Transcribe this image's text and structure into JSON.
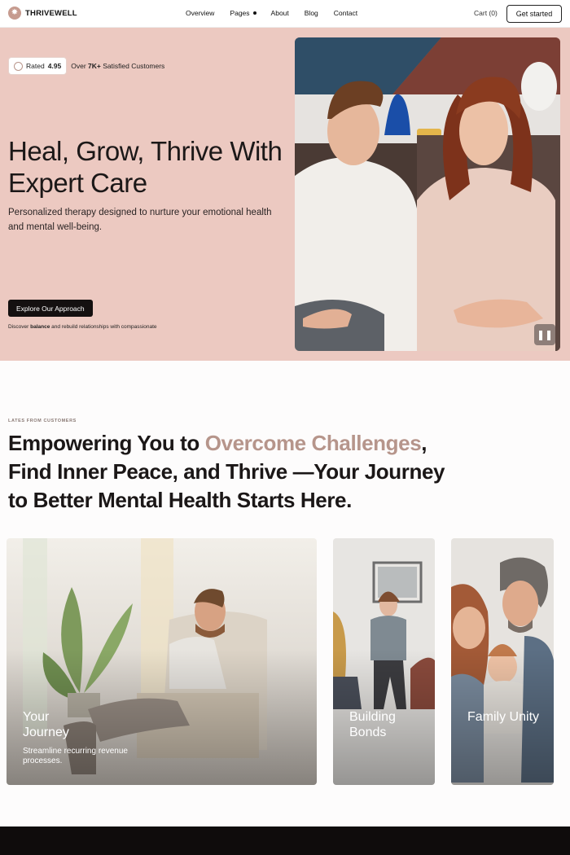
{
  "brand": {
    "name": "THRIVEWELL"
  },
  "nav": {
    "links": [
      "Overview",
      "Pages",
      "About",
      "Blog",
      "Contact"
    ],
    "cart": "Cart (0)",
    "cta": "Get started"
  },
  "hero": {
    "rating_label": "Rated",
    "rating_value": "4.95",
    "customers_prefix": "Over",
    "customers_count": "7K+",
    "customers_suffix": "Satisfied Customers",
    "title": "Heal, Grow, Thrive With Expert Care",
    "subtitle": "Personalized therapy designed to nurture your emotional health and mental well-being.",
    "cta": "Explore Our Approach",
    "note_pre": "Discover",
    "note_bold": "balance",
    "note_post": "and rebuild relationships with compassionate"
  },
  "section": {
    "eyebrow": "LATES FROM CUSTOMERS",
    "title_pre": "Empowering You to ",
    "title_accent": "Overcome Challenges",
    "title_post": ", Find Inner Peace, and Thrive —Your Journey to Better Mental Health Starts Here."
  },
  "cards": [
    {
      "title": "Your Journey",
      "desc": "Streamline recurring revenue processes."
    },
    {
      "title": "Building Bonds"
    },
    {
      "title": "Family Unity"
    }
  ],
  "colors": {
    "hero_bg": "#ecc9c1",
    "accent": "#b6958b",
    "footer": "#0f0c0c"
  },
  "icons": [
    "logo-star-icon",
    "rating-star-icon",
    "pause-icon"
  ]
}
